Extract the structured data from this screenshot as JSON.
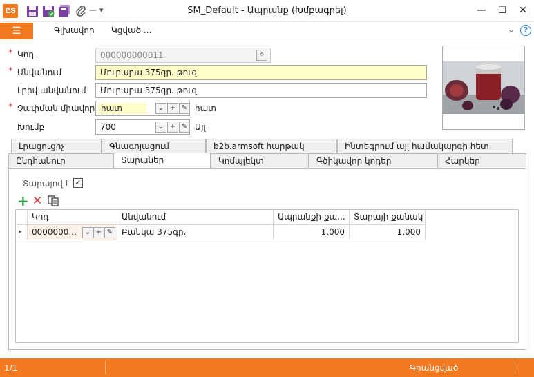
{
  "window": {
    "title": "SM_Default - Ապրանք (Խմբագրել)",
    "logo": "ԸՏ",
    "buttons": {
      "minimize": "—",
      "maximize": "☐",
      "close": "✕"
    }
  },
  "quick_access": {
    "icons": [
      "save-icon",
      "save-close-icon",
      "save-new-icon",
      "attach-icon"
    ],
    "dropdown": "▾"
  },
  "menu": {
    "file_icon": "☰",
    "items": [
      "Գլխավոր",
      "Կցված ..."
    ],
    "collapse": "⌄",
    "help": "?"
  },
  "form": {
    "required_mark": "*",
    "code": {
      "label": "Կոդ",
      "value": "000000000011",
      "required": true
    },
    "name": {
      "label": "Անվանում",
      "value": "Մուրաբա 375գր. թուզ",
      "required": true
    },
    "full_name": {
      "label": "Լրիվ անվանում",
      "value": "Մուրաբա 375գր. թուզ",
      "required": false
    },
    "unit": {
      "label": "Չափման միավոր",
      "value": "հատ",
      "suffix": "հատ",
      "required": true
    },
    "group": {
      "label": "Խումբ",
      "value": "700",
      "suffix": "Այլ",
      "required": false
    },
    "lookup_buttons": {
      "dropdown": "⌄",
      "add": "+",
      "edit": "✎"
    }
  },
  "tabs": {
    "row1": [
      "Լրացուցիչ",
      "Գնագոյացում",
      "b2b.armsoft հարթակ",
      "Ինտեգրում այլ համակարգի հետ"
    ],
    "row2": [
      "Ընդհանուր",
      "Տարաներ",
      "Կոմպլեկտ",
      "Գծիկավոր կոդեր",
      "Հարկեր"
    ],
    "active": "Տարաներ"
  },
  "containers_panel": {
    "is_container_label": "Տարայով է",
    "is_container_checked": true,
    "toolbar": {
      "add": "+",
      "delete": "✕",
      "copy": "⧉"
    },
    "columns": [
      "Կոդ",
      "Անվանում",
      "Ապրանքի քա...",
      "Տարայի քանակ"
    ],
    "rows": [
      {
        "indicator": "▸",
        "code": "0000000...",
        "name": "Բանկա 375գր.",
        "product_qty": "1.000",
        "container_qty": "1.000"
      }
    ]
  },
  "status": {
    "record": "1/1",
    "state": "Գրանցված"
  },
  "colors": {
    "accent": "#f47a20",
    "required": "#d23a3a",
    "highlight_field": "#fffdc8",
    "help": "#2a7fd4"
  }
}
